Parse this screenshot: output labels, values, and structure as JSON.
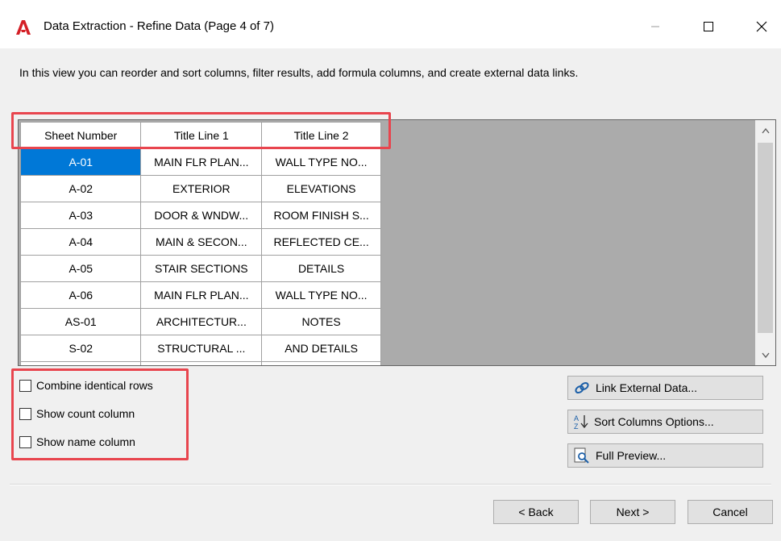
{
  "window": {
    "title": "Data Extraction - Refine Data (Page 4 of 7)",
    "brand_color": "#d41f26",
    "accent_color": "#0078d7"
  },
  "description": "In this view you can reorder and sort columns, filter results, add formula columns, and create external data links.",
  "grid": {
    "columns": [
      "Sheet Number",
      "Title Line 1",
      "Title Line 2"
    ],
    "rows": [
      [
        "A-01",
        "MAIN FLR PLAN...",
        "WALL TYPE NO..."
      ],
      [
        "A-02",
        "EXTERIOR",
        "ELEVATIONS"
      ],
      [
        "A-03",
        "DOOR & WNDW...",
        "ROOM FINISH S..."
      ],
      [
        "A-04",
        "MAIN & SECON...",
        "REFLECTED CE..."
      ],
      [
        "A-05",
        "STAIR SECTIONS",
        "DETAILS"
      ],
      [
        "A-06",
        "MAIN FLR PLAN...",
        "WALL TYPE NO..."
      ],
      [
        "AS-01",
        "ARCHITECTUR...",
        "NOTES"
      ],
      [
        "S-02",
        "STRUCTURAL ...",
        "AND DETAILS"
      ]
    ],
    "selected_cell": "A-01"
  },
  "options": {
    "combine_identical_rows": {
      "label": "Combine identical rows",
      "checked": false
    },
    "show_count_column": {
      "label": "Show count column",
      "checked": false
    },
    "show_name_column": {
      "label": "Show name column",
      "checked": false
    }
  },
  "actions": {
    "link_external": {
      "label": "Link External Data...",
      "icon": "link-icon"
    },
    "sort_columns": {
      "label": "Sort Columns Options...",
      "icon": "sort-az-icon"
    },
    "full_preview": {
      "label": "Full Preview...",
      "icon": "preview-icon"
    }
  },
  "footer": {
    "back": "< Back",
    "next": "Next >",
    "cancel": "Cancel"
  },
  "highlight_color": "#e8454e"
}
